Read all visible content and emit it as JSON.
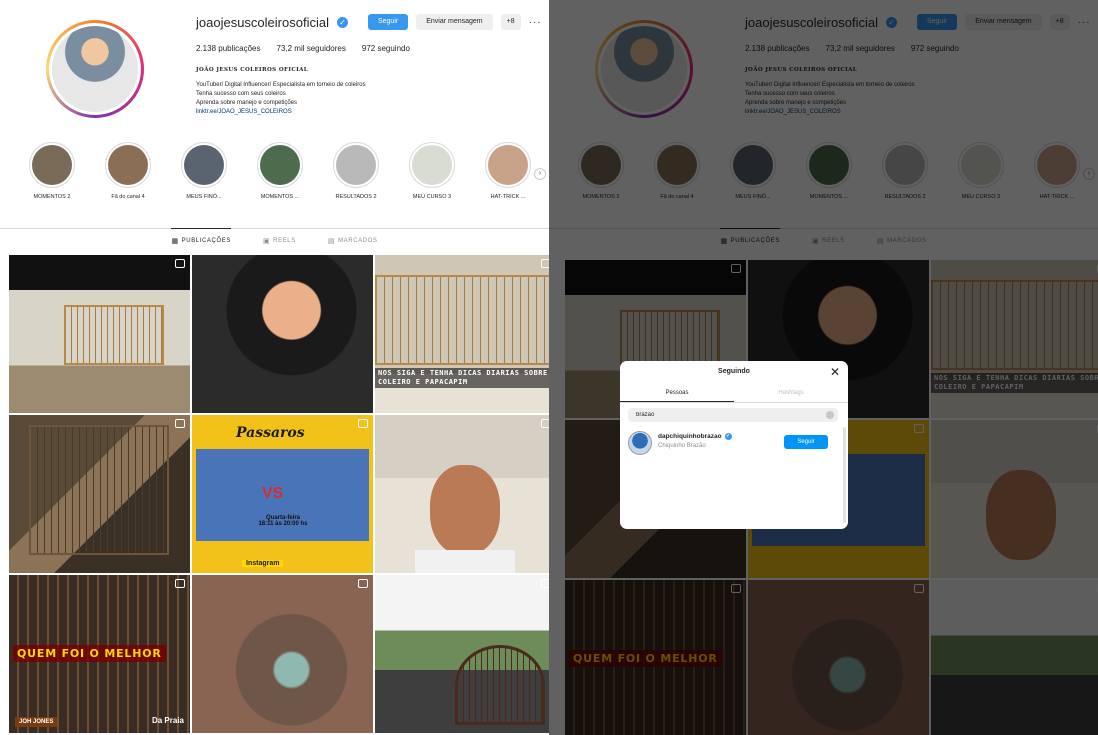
{
  "profile": {
    "username": "joaojesuscoleirosoficial",
    "follow_label": "Seguir",
    "message_label": "Enviar mensagem",
    "add_icon": "+8",
    "more_label": "···",
    "stats": {
      "posts": "2.138 publicações",
      "followers": "73,2 mil seguidores",
      "following": "972 seguindo"
    },
    "bio": {
      "name": "JOÃO JESUS COLEIROS OFICIAL",
      "line1": "YouTuber/ Digital Influencer/ Especialista em torneio de coleiros",
      "line2": "Tenha sucesso com seus coleiros",
      "line3": "Aprenda sobre manejo e competições",
      "link": "linktr.ee/JOAO_JESUS_COLEIROS"
    }
  },
  "highlights": [
    {
      "label": "MOMENTOS 2",
      "color": "#7a6a58"
    },
    {
      "label": "Fã do canal 4",
      "color": "#8a6e55"
    },
    {
      "label": "MEUS FINÓ...",
      "color": "#5a6470"
    },
    {
      "label": "MOMENTOS ...",
      "color": "#4e6b4e"
    },
    {
      "label": "RESULTADOS 2",
      "color": "#b9b9b9"
    },
    {
      "label": "MEU CURSO 3",
      "color": "#d9dcd3"
    },
    {
      "label": "HAT-TRICK ...",
      "color": "#c9a28a"
    }
  ],
  "tabs": {
    "posts": "PUBLICAÇÕES",
    "reels": "REELS",
    "tagged": "MARCADOS"
  },
  "posts": {
    "p3_text": "NOS SIGA E TENHA DICAS DIARIAS SOBRE COLEIRO E PAPACAPIM",
    "p5_title": "Passaros",
    "p5_vs": "VS",
    "p5_date": "Quarta-feira 18:11 às 20:00 hs",
    "p5_foot": "Instagram",
    "p7_text": "QUEM FOI O MELHOR",
    "p7_badge1": "JOH JONES",
    "p7_badge2": "Da Praia"
  },
  "modal": {
    "title": "Seguindo",
    "tab_people": "Pessoas",
    "tab_hashtags": "Hashtags",
    "search_value": "brazão",
    "result_username": "dapchiquinhobrazao",
    "result_name": "Chiquinho Brazão",
    "result_button": "Seguir"
  }
}
